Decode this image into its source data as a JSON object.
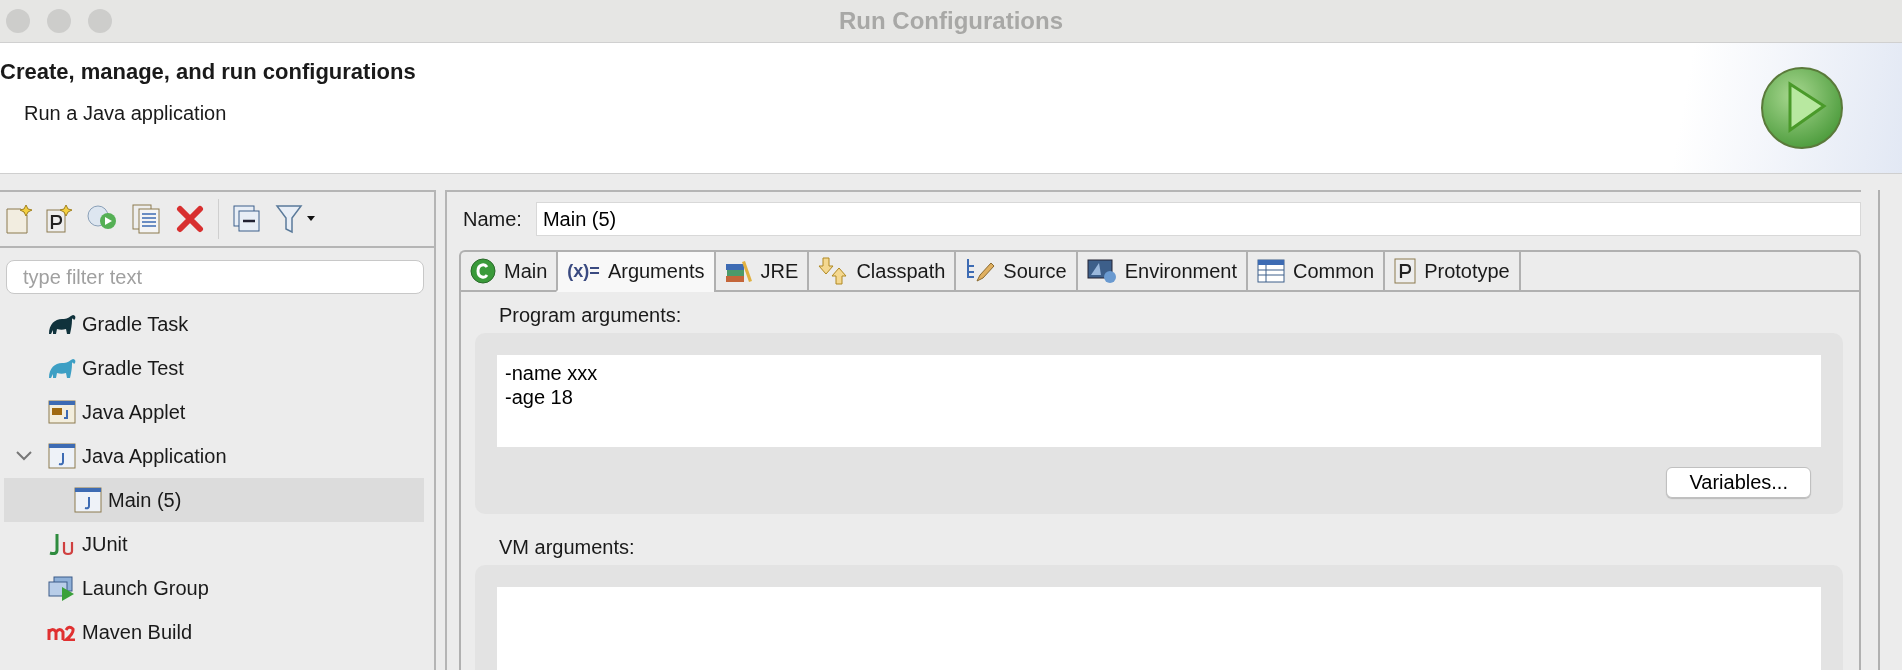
{
  "window": {
    "title": "Run Configurations"
  },
  "header": {
    "title": "Create, manage, and run configurations",
    "subtitle": "Run a Java application"
  },
  "filter": {
    "placeholder": "type filter text"
  },
  "tree": [
    {
      "label": "Gradle Task",
      "kind": "gradle-task",
      "selected": false
    },
    {
      "label": "Gradle Test",
      "kind": "gradle-test",
      "selected": false
    },
    {
      "label": "Java Applet",
      "kind": "applet",
      "selected": false
    },
    {
      "label": "Java Application",
      "kind": "application",
      "selected": false,
      "expanded": true,
      "children": [
        {
          "label": "Main (5)",
          "kind": "application",
          "selected": true
        }
      ]
    },
    {
      "label": "JUnit",
      "kind": "junit",
      "selected": false
    },
    {
      "label": "Launch Group",
      "kind": "launch-group",
      "selected": false
    },
    {
      "label": "Maven Build",
      "kind": "maven",
      "selected": false
    }
  ],
  "name_field": {
    "label": "Name:",
    "value": "Main (5)"
  },
  "tabs": [
    {
      "label": "Main",
      "kind": "main",
      "selected": false
    },
    {
      "label": "Arguments",
      "kind": "arguments",
      "symbol": "(x)=",
      "selected": true
    },
    {
      "label": "JRE",
      "kind": "jre",
      "selected": false
    },
    {
      "label": "Classpath",
      "kind": "classpath",
      "selected": false
    },
    {
      "label": "Source",
      "kind": "source",
      "selected": false
    },
    {
      "label": "Environment",
      "kind": "environment",
      "selected": false
    },
    {
      "label": "Common",
      "kind": "common",
      "selected": false
    },
    {
      "label": "Prototype",
      "kind": "prototype",
      "selected": false
    }
  ],
  "program_arguments": {
    "label": "Program arguments:",
    "value": "-name xxx\n-age 18",
    "button": "Variables..."
  },
  "vm_arguments": {
    "label": "VM arguments:"
  }
}
